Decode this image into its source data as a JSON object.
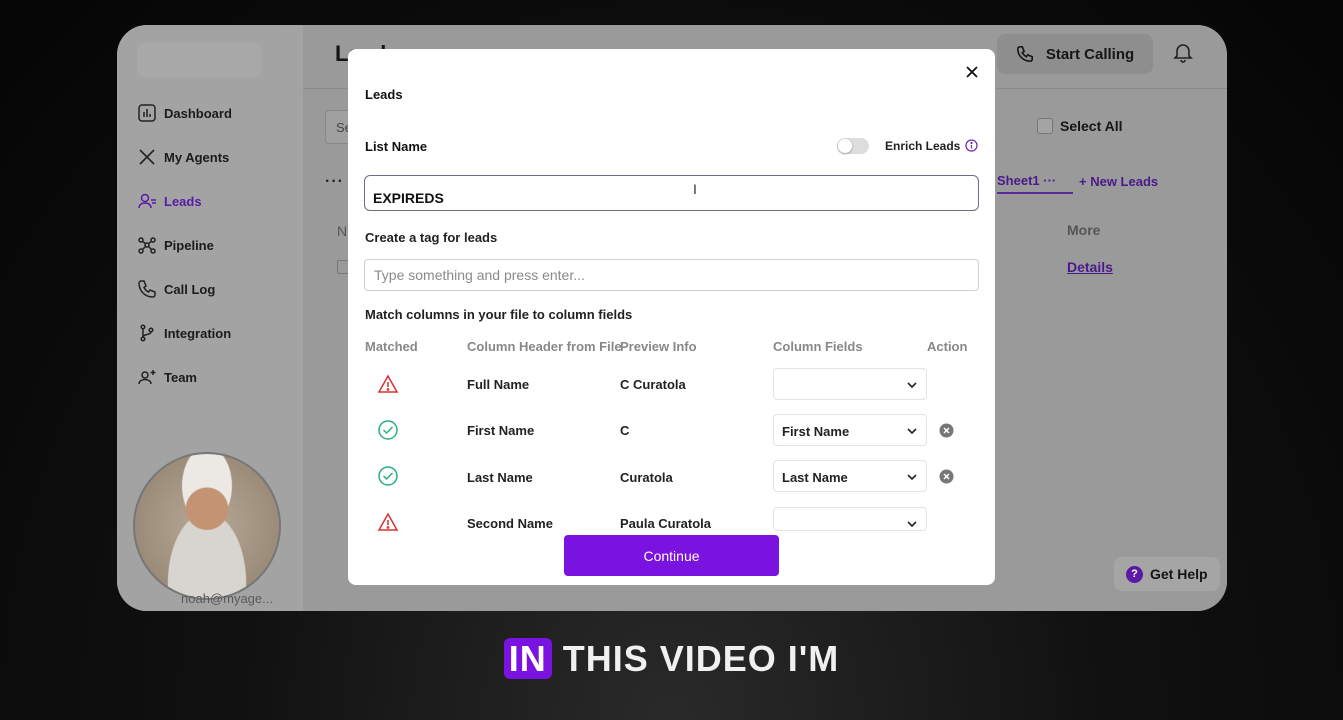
{
  "sidebar": {
    "items": [
      {
        "label": "Dashboard",
        "icon": "dashboard-icon"
      },
      {
        "label": "My Agents",
        "icon": "agents-icon"
      },
      {
        "label": "Leads",
        "icon": "leads-icon",
        "active": true
      },
      {
        "label": "Pipeline",
        "icon": "pipeline-icon"
      },
      {
        "label": "Call Log",
        "icon": "phone-icon"
      },
      {
        "label": "Integration",
        "icon": "integration-icon"
      },
      {
        "label": "Team",
        "icon": "team-icon"
      }
    ],
    "user_email": "noah@myage..."
  },
  "header": {
    "title": "Leads",
    "start_calling": "Start Calling"
  },
  "background_page": {
    "search_placeholder": "Se",
    "column_n": "N",
    "select_all": "Select All",
    "sheet_tab": "Sheet1",
    "new_leads": "New Leads",
    "more_col": "More",
    "details_link": "Details",
    "get_help": "Get Help"
  },
  "modal": {
    "title": "Leads",
    "list_name_label": "List Name",
    "enrich_label": "Enrich Leads",
    "list_name_value": "EXPIREDS",
    "tag_label": "Create a tag for leads",
    "tag_placeholder": "Type something and press enter...",
    "match_label": "Match columns in your file to column fields",
    "headers": {
      "matched": "Matched",
      "column_header": "Column Header from File",
      "preview": "Preview Info",
      "fields": "Column Fields",
      "action": "Action"
    },
    "rows": [
      {
        "status": "warning",
        "header": "Full Name",
        "preview": "C Curatola",
        "field": ""
      },
      {
        "status": "matched",
        "header": "First Name",
        "preview": "C",
        "field": "First Name"
      },
      {
        "status": "matched",
        "header": "Last Name",
        "preview": "Curatola",
        "field": "Last Name"
      },
      {
        "status": "warning",
        "header": "Second Name",
        "preview": "Paula Curatola",
        "field": ""
      }
    ],
    "continue_label": "Continue"
  },
  "caption": {
    "highlight": "IN",
    "rest": "THIS VIDEO I'M"
  },
  "colors": {
    "accent": "#7a12e0",
    "warning": "#d93030",
    "success": "#2bb07a"
  }
}
